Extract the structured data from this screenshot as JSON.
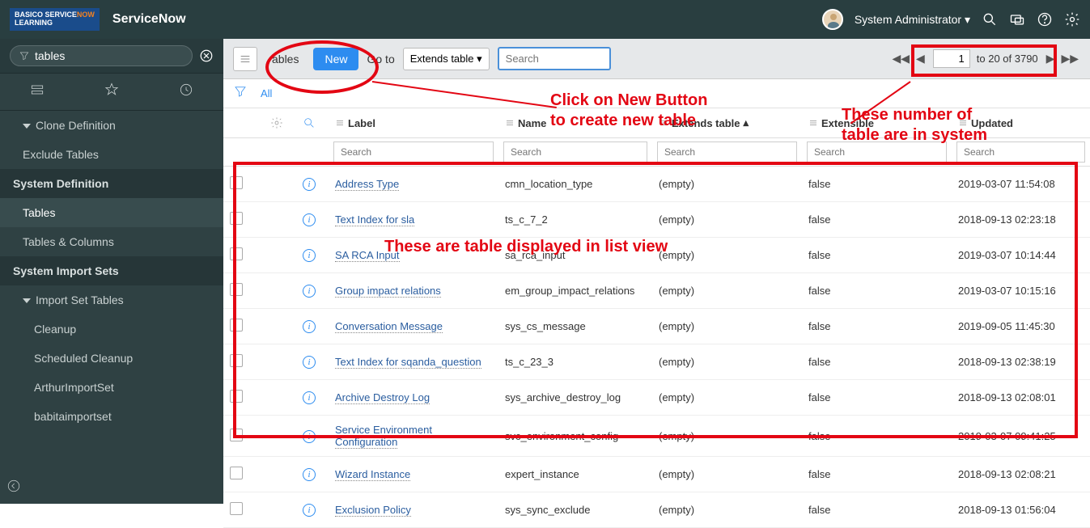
{
  "header": {
    "logo_line1": "BASICO",
    "logo_line2_a": "SERVICE",
    "logo_line2_b": "NOW",
    "logo_line3": "LEARNING",
    "app_name": "ServiceNow",
    "user_name": "System Administrator"
  },
  "sidebar": {
    "filter_value": "tables",
    "items": [
      {
        "label": "Clone Definition",
        "cls": "sub caret-item"
      },
      {
        "label": "Exclude Tables",
        "cls": "sub"
      },
      {
        "label": "System Definition",
        "cls": "section"
      },
      {
        "label": "Tables",
        "cls": "sub active"
      },
      {
        "label": "Tables & Columns",
        "cls": "sub"
      },
      {
        "label": "System Import Sets",
        "cls": "section"
      },
      {
        "label": "Import Set Tables",
        "cls": "sub caret-item"
      },
      {
        "label": "Cleanup",
        "cls": "sub2"
      },
      {
        "label": "Scheduled Cleanup",
        "cls": "sub2"
      },
      {
        "label": "ArthurImportSet",
        "cls": "sub2"
      },
      {
        "label": "babitaimportset",
        "cls": "sub2"
      }
    ]
  },
  "toolbar": {
    "crumb": "ables",
    "new_label": "New",
    "goto_label": "Go to",
    "ext_label": "Extends table",
    "search_placeholder": "Search",
    "page_value": "1",
    "page_info": "to 20 of 3790"
  },
  "filter": {
    "all_label": "All"
  },
  "columns": {
    "label": "Label",
    "name": "Name",
    "ext": "Extends table",
    "extn": "Extensible",
    "upd": "Updated",
    "search_placeholder": "Search"
  },
  "rows": [
    {
      "label": "Address Type",
      "name": "cmn_location_type",
      "ext": "(empty)",
      "extn": "false",
      "upd": "2019-03-07 11:54:08"
    },
    {
      "label": "Text Index for sla",
      "name": "ts_c_7_2",
      "ext": "(empty)",
      "extn": "false",
      "upd": "2018-09-13 02:23:18"
    },
    {
      "label": "SA RCA Input",
      "name": "sa_rca_input",
      "ext": "(empty)",
      "extn": "false",
      "upd": "2019-03-07 10:14:44"
    },
    {
      "label": "Group impact relations",
      "name": "em_group_impact_relations",
      "ext": "(empty)",
      "extn": "false",
      "upd": "2019-03-07 10:15:16"
    },
    {
      "label": "Conversation Message",
      "name": "sys_cs_message",
      "ext": "(empty)",
      "extn": "false",
      "upd": "2019-09-05 11:45:30"
    },
    {
      "label": "Text Index for sqanda_question",
      "name": "ts_c_23_3",
      "ext": "(empty)",
      "extn": "false",
      "upd": "2018-09-13 02:38:19"
    },
    {
      "label": "Archive Destroy Log",
      "name": "sys_archive_destroy_log",
      "ext": "(empty)",
      "extn": "false",
      "upd": "2018-09-13 02:08:01"
    },
    {
      "label": "Service Environment Configuration",
      "name": "svc_environment_config",
      "ext": "(empty)",
      "extn": "false",
      "upd": "2019-03-07 09:41:25"
    },
    {
      "label": "Wizard Instance",
      "name": "expert_instance",
      "ext": "(empty)",
      "extn": "false",
      "upd": "2018-09-13 02:08:21"
    },
    {
      "label": "Exclusion Policy",
      "name": "sys_sync_exclude",
      "ext": "(empty)",
      "extn": "false",
      "upd": "2018-09-13 01:56:04"
    }
  ],
  "annotations": {
    "a1_l1": "Click on New Button",
    "a1_l2": "to create new table",
    "a2_l1": "These number of",
    "a2_l2": "table are in system",
    "a3": "These are table displayed in list view"
  }
}
